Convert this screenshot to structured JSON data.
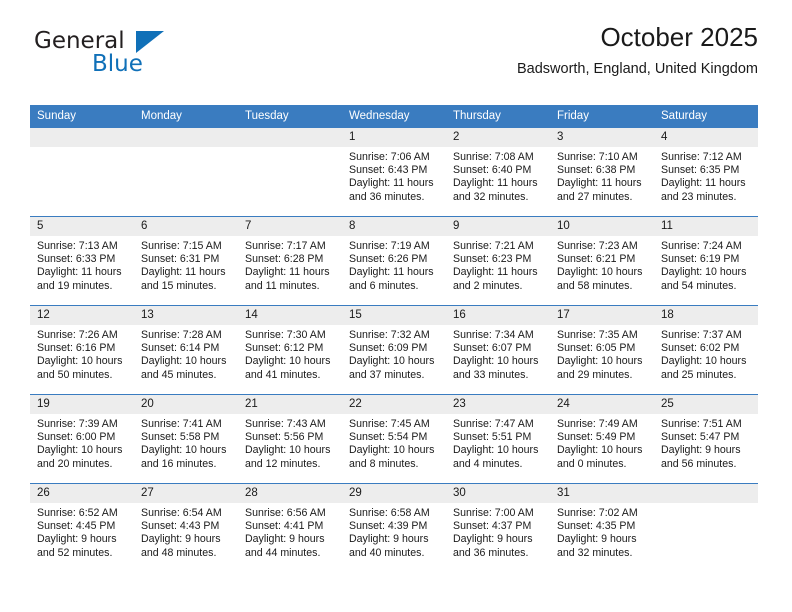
{
  "brand": {
    "name_part1": "General",
    "name_part2": "Blue",
    "triangle_color": "#1070b8"
  },
  "header": {
    "title": "October 2025",
    "location": "Badsworth, England, United Kingdom"
  },
  "theme": {
    "header_blue": "#3a7cc0",
    "daynum_gray": "#ededed",
    "text": "#1a1a1a"
  },
  "weekday_headers": [
    "Sunday",
    "Monday",
    "Tuesday",
    "Wednesday",
    "Thursday",
    "Friday",
    "Saturday"
  ],
  "labels": {
    "sunrise_prefix": "Sunrise:",
    "sunset_prefix": "Sunset:",
    "daylight_prefix": "Daylight:"
  },
  "weeks": [
    [
      {
        "day": "",
        "empty": true
      },
      {
        "day": "",
        "empty": true
      },
      {
        "day": "",
        "empty": true
      },
      {
        "day": "1",
        "sunrise": "Sunrise: 7:06 AM",
        "sunset": "Sunset: 6:43 PM",
        "daylight_l1": "Daylight: 11 hours",
        "daylight_l2": "and 36 minutes."
      },
      {
        "day": "2",
        "sunrise": "Sunrise: 7:08 AM",
        "sunset": "Sunset: 6:40 PM",
        "daylight_l1": "Daylight: 11 hours",
        "daylight_l2": "and 32 minutes."
      },
      {
        "day": "3",
        "sunrise": "Sunrise: 7:10 AM",
        "sunset": "Sunset: 6:38 PM",
        "daylight_l1": "Daylight: 11 hours",
        "daylight_l2": "and 27 minutes."
      },
      {
        "day": "4",
        "sunrise": "Sunrise: 7:12 AM",
        "sunset": "Sunset: 6:35 PM",
        "daylight_l1": "Daylight: 11 hours",
        "daylight_l2": "and 23 minutes."
      }
    ],
    [
      {
        "day": "5",
        "sunrise": "Sunrise: 7:13 AM",
        "sunset": "Sunset: 6:33 PM",
        "daylight_l1": "Daylight: 11 hours",
        "daylight_l2": "and 19 minutes."
      },
      {
        "day": "6",
        "sunrise": "Sunrise: 7:15 AM",
        "sunset": "Sunset: 6:31 PM",
        "daylight_l1": "Daylight: 11 hours",
        "daylight_l2": "and 15 minutes."
      },
      {
        "day": "7",
        "sunrise": "Sunrise: 7:17 AM",
        "sunset": "Sunset: 6:28 PM",
        "daylight_l1": "Daylight: 11 hours",
        "daylight_l2": "and 11 minutes."
      },
      {
        "day": "8",
        "sunrise": "Sunrise: 7:19 AM",
        "sunset": "Sunset: 6:26 PM",
        "daylight_l1": "Daylight: 11 hours",
        "daylight_l2": "and 6 minutes."
      },
      {
        "day": "9",
        "sunrise": "Sunrise: 7:21 AM",
        "sunset": "Sunset: 6:23 PM",
        "daylight_l1": "Daylight: 11 hours",
        "daylight_l2": "and 2 minutes."
      },
      {
        "day": "10",
        "sunrise": "Sunrise: 7:23 AM",
        "sunset": "Sunset: 6:21 PM",
        "daylight_l1": "Daylight: 10 hours",
        "daylight_l2": "and 58 minutes."
      },
      {
        "day": "11",
        "sunrise": "Sunrise: 7:24 AM",
        "sunset": "Sunset: 6:19 PM",
        "daylight_l1": "Daylight: 10 hours",
        "daylight_l2": "and 54 minutes."
      }
    ],
    [
      {
        "day": "12",
        "sunrise": "Sunrise: 7:26 AM",
        "sunset": "Sunset: 6:16 PM",
        "daylight_l1": "Daylight: 10 hours",
        "daylight_l2": "and 50 minutes."
      },
      {
        "day": "13",
        "sunrise": "Sunrise: 7:28 AM",
        "sunset": "Sunset: 6:14 PM",
        "daylight_l1": "Daylight: 10 hours",
        "daylight_l2": "and 45 minutes."
      },
      {
        "day": "14",
        "sunrise": "Sunrise: 7:30 AM",
        "sunset": "Sunset: 6:12 PM",
        "daylight_l1": "Daylight: 10 hours",
        "daylight_l2": "and 41 minutes."
      },
      {
        "day": "15",
        "sunrise": "Sunrise: 7:32 AM",
        "sunset": "Sunset: 6:09 PM",
        "daylight_l1": "Daylight: 10 hours",
        "daylight_l2": "and 37 minutes."
      },
      {
        "day": "16",
        "sunrise": "Sunrise: 7:34 AM",
        "sunset": "Sunset: 6:07 PM",
        "daylight_l1": "Daylight: 10 hours",
        "daylight_l2": "and 33 minutes."
      },
      {
        "day": "17",
        "sunrise": "Sunrise: 7:35 AM",
        "sunset": "Sunset: 6:05 PM",
        "daylight_l1": "Daylight: 10 hours",
        "daylight_l2": "and 29 minutes."
      },
      {
        "day": "18",
        "sunrise": "Sunrise: 7:37 AM",
        "sunset": "Sunset: 6:02 PM",
        "daylight_l1": "Daylight: 10 hours",
        "daylight_l2": "and 25 minutes."
      }
    ],
    [
      {
        "day": "19",
        "sunrise": "Sunrise: 7:39 AM",
        "sunset": "Sunset: 6:00 PM",
        "daylight_l1": "Daylight: 10 hours",
        "daylight_l2": "and 20 minutes."
      },
      {
        "day": "20",
        "sunrise": "Sunrise: 7:41 AM",
        "sunset": "Sunset: 5:58 PM",
        "daylight_l1": "Daylight: 10 hours",
        "daylight_l2": "and 16 minutes."
      },
      {
        "day": "21",
        "sunrise": "Sunrise: 7:43 AM",
        "sunset": "Sunset: 5:56 PM",
        "daylight_l1": "Daylight: 10 hours",
        "daylight_l2": "and 12 minutes."
      },
      {
        "day": "22",
        "sunrise": "Sunrise: 7:45 AM",
        "sunset": "Sunset: 5:54 PM",
        "daylight_l1": "Daylight: 10 hours",
        "daylight_l2": "and 8 minutes."
      },
      {
        "day": "23",
        "sunrise": "Sunrise: 7:47 AM",
        "sunset": "Sunset: 5:51 PM",
        "daylight_l1": "Daylight: 10 hours",
        "daylight_l2": "and 4 minutes."
      },
      {
        "day": "24",
        "sunrise": "Sunrise: 7:49 AM",
        "sunset": "Sunset: 5:49 PM",
        "daylight_l1": "Daylight: 10 hours",
        "daylight_l2": "and 0 minutes."
      },
      {
        "day": "25",
        "sunrise": "Sunrise: 7:51 AM",
        "sunset": "Sunset: 5:47 PM",
        "daylight_l1": "Daylight: 9 hours",
        "daylight_l2": "and 56 minutes."
      }
    ],
    [
      {
        "day": "26",
        "sunrise": "Sunrise: 6:52 AM",
        "sunset": "Sunset: 4:45 PM",
        "daylight_l1": "Daylight: 9 hours",
        "daylight_l2": "and 52 minutes."
      },
      {
        "day": "27",
        "sunrise": "Sunrise: 6:54 AM",
        "sunset": "Sunset: 4:43 PM",
        "daylight_l1": "Daylight: 9 hours",
        "daylight_l2": "and 48 minutes."
      },
      {
        "day": "28",
        "sunrise": "Sunrise: 6:56 AM",
        "sunset": "Sunset: 4:41 PM",
        "daylight_l1": "Daylight: 9 hours",
        "daylight_l2": "and 44 minutes."
      },
      {
        "day": "29",
        "sunrise": "Sunrise: 6:58 AM",
        "sunset": "Sunset: 4:39 PM",
        "daylight_l1": "Daylight: 9 hours",
        "daylight_l2": "and 40 minutes."
      },
      {
        "day": "30",
        "sunrise": "Sunrise: 7:00 AM",
        "sunset": "Sunset: 4:37 PM",
        "daylight_l1": "Daylight: 9 hours",
        "daylight_l2": "and 36 minutes."
      },
      {
        "day": "31",
        "sunrise": "Sunrise: 7:02 AM",
        "sunset": "Sunset: 4:35 PM",
        "daylight_l1": "Daylight: 9 hours",
        "daylight_l2": "and 32 minutes."
      },
      {
        "day": "",
        "empty": true
      }
    ]
  ]
}
